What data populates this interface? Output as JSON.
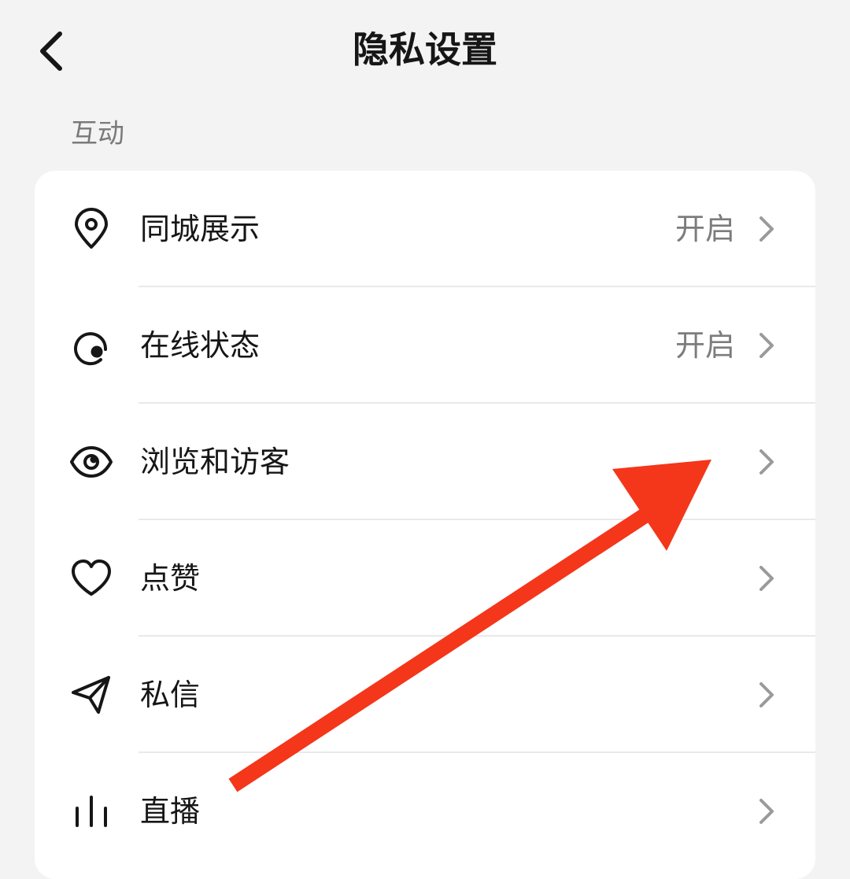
{
  "header": {
    "title": "隐私设置",
    "back_icon": "chevron-left-icon"
  },
  "section": {
    "label": "互动"
  },
  "rows": [
    {
      "icon": "location-pin-icon",
      "label": "同城展示",
      "value": "开启"
    },
    {
      "icon": "online-status-icon",
      "label": "在线状态",
      "value": "开启"
    },
    {
      "icon": "eye-icon",
      "label": "浏览和访客",
      "value": ""
    },
    {
      "icon": "heart-icon",
      "label": "点赞",
      "value": ""
    },
    {
      "icon": "paper-plane-icon",
      "label": "私信",
      "value": ""
    },
    {
      "icon": "live-bars-icon",
      "label": "直播",
      "value": ""
    }
  ],
  "colors": {
    "background": "#f3f3f3",
    "card": "#ffffff",
    "text": "#161616",
    "secondary_text": "#7c7c7c",
    "chevron": "#9a9a9a",
    "annotation_arrow": "#f4361a"
  }
}
